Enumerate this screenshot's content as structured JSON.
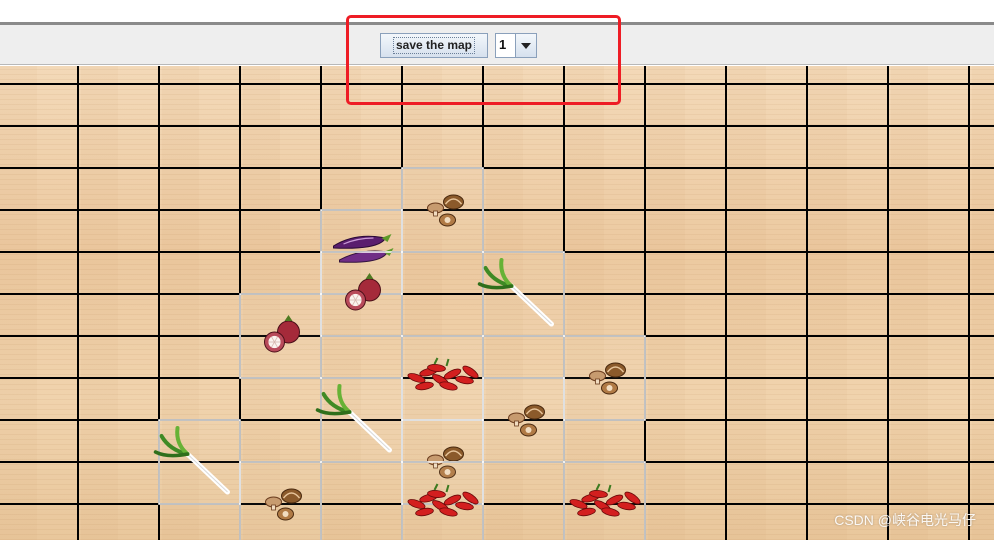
{
  "toolbar": {
    "save_label": "save the map",
    "level_select": {
      "selected": "1"
    }
  },
  "board": {
    "grid": {
      "cols": 13,
      "rows": 12
    },
    "tiles": [
      {
        "col": 5,
        "row": 3,
        "item": "mushroom"
      },
      {
        "col": 4,
        "row": 4,
        "item": "eggplant"
      },
      {
        "col": 4,
        "row": 5,
        "item": "mangosteen"
      },
      {
        "col": 6,
        "row": 5,
        "item": "leek"
      },
      {
        "col": 3,
        "row": 6,
        "item": "mangosteen"
      },
      {
        "col": 5,
        "row": 7,
        "item": "chili"
      },
      {
        "col": 7,
        "row": 7,
        "item": "mushroom"
      },
      {
        "col": 4,
        "row": 8,
        "item": "leek"
      },
      {
        "col": 6,
        "row": 8,
        "item": "mushroom"
      },
      {
        "col": 2,
        "row": 9,
        "item": "leek"
      },
      {
        "col": 5,
        "row": 9,
        "item": "mushroom"
      },
      {
        "col": 3,
        "row": 10,
        "item": "mushroom"
      },
      {
        "col": 5,
        "row": 10,
        "item": "chili"
      },
      {
        "col": 7,
        "row": 10,
        "item": "chili"
      }
    ]
  },
  "watermark": "CSDN @峡谷电光马仔"
}
